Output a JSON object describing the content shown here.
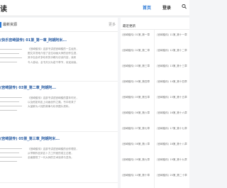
{
  "header": {
    "site_title": "读",
    "nav_home": "首页",
    "nav_login": "登录"
  },
  "main": {
    "section_title": "最新资源",
    "more_label": "更多",
    "articles": [
      {
        "title": "(快乐宫崎骏传) 01第_第一章_阿朗阿米...",
        "lines": [
          "《宫崎骏传》这部书讲述宫崎骏的一生经历，",
          "图文并茂地介绍了这位动画大师的创作生涯，",
          "其中包含许多珍贵的手稿与访谈内容，读来",
          "令人感动。全书共分为若干章节，欢迎阅读。"
        ]
      },
      {
        "title": "(宫崎骏传) 03第_第二章_阿朗阿...",
        "lines": [
          "《宫崎骏传》这部书讲述宫崎骏的童年时光，",
          "以及他如何走上动画创作之路，书中收录了",
          "大量鲜为人知的故事与珍贵图片资料。"
        ]
      },
      {
        "title": "(宫崎骏传) 05第_第三章_阿朗阿米...",
        "lines": [
          "《宫崎骏传》这部书讲述宫崎骏的创作理念，",
          "从早期作品到吉卜力工作室的成立过程，",
          "全面展现了一代大师的艺术追求与坚持。"
        ]
      }
    ]
  },
  "sidebar": {
    "title": "最近更新",
    "left_items": [
      "(宫崎骏传) 01第_第一章",
      "(宫崎骏传) 02第_第二章",
      "(宫崎骏传) 03第_第三章",
      "(宫崎骏传) 04第_第四章",
      "(宫崎骏传) 05第_第五章",
      "(宫崎骏传) 06第_第六章",
      "(宫崎骏传) 07第_第七章",
      "(宫崎骏传) 08第_第八章",
      "(宫崎骏传) 09第_第九章",
      "(宫崎骏传) 10第_第十章"
    ],
    "right_items": [
      "(宫崎骏传) 11第_第十一章",
      "(宫崎骏传) 12第_第十二章",
      "(宫崎骏传) 13第_第十三章",
      "(宫崎骏传) 14第_第十四章",
      "(宫崎骏传) 15第_第十五章",
      "(宫崎骏传) 16第_第十六章",
      "(宫崎骏传) 17第_第十七章",
      "(宫崎骏传) 18第_第十八章",
      "(宫崎骏传) 19第_第十九章",
      "(宫崎骏传) 20第_第二十章"
    ]
  },
  "icons": {
    "search": "search-icon"
  },
  "colors": {
    "accent": "#2c7ad6",
    "link": "#2c5fa5",
    "background": "#f4f5f7"
  }
}
